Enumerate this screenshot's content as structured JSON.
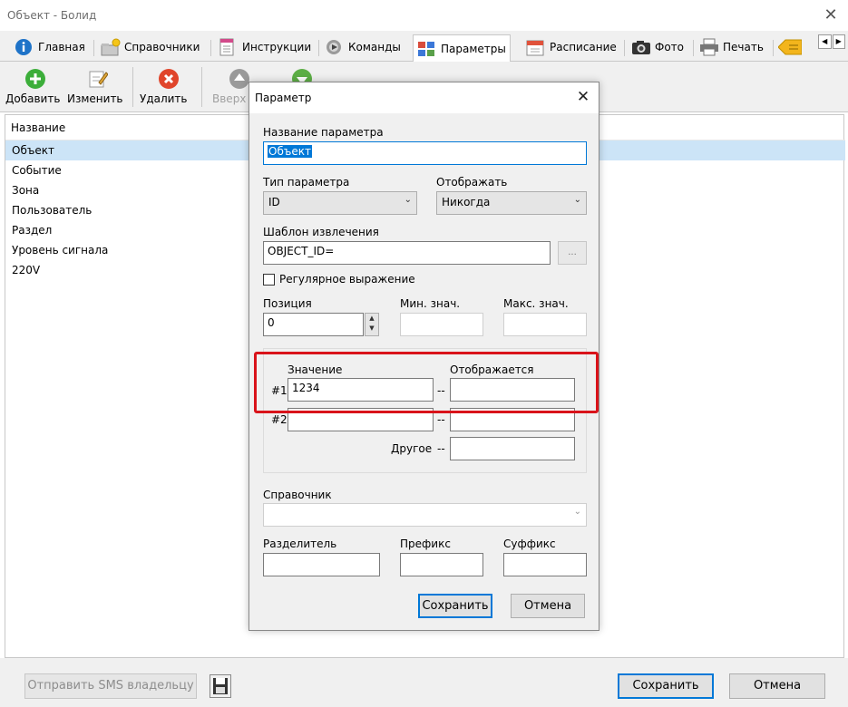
{
  "window": {
    "title": "Объект - Болид",
    "close_glyph": "✕"
  },
  "tabs": [
    {
      "label": "Главная",
      "icon": "info-icon"
    },
    {
      "label": "Справочники",
      "icon": "folder-star-icon"
    },
    {
      "label": "Инструкции",
      "icon": "document-icon"
    },
    {
      "label": "Команды",
      "icon": "gear-play-icon"
    },
    {
      "label": "Параметры",
      "icon": "grid-icon",
      "active": true
    },
    {
      "label": "Расписание",
      "icon": "calendar-icon"
    },
    {
      "label": "Фото",
      "icon": "camera-icon"
    },
    {
      "label": "Печать",
      "icon": "printer-icon"
    }
  ],
  "tab_scroll": {
    "left": "◀",
    "right": "▶"
  },
  "toolbar": {
    "add": "Добавить",
    "edit": "Изменить",
    "delete": "Удалить",
    "up": "Вверх"
  },
  "list": {
    "header": "Название",
    "items": [
      "Объект",
      "Событие",
      "Зона",
      "Пользователь",
      "Раздел",
      "Уровень сигнала",
      "220V"
    ],
    "selected_index": 0
  },
  "bottom": {
    "sms_button": "Отправить SMS владельцу",
    "save_button": "Сохранить",
    "cancel_button": "Отмена"
  },
  "dialog": {
    "title": "Параметр",
    "close_glyph": "✕",
    "param_name_label": "Название параметра",
    "param_name_value": "Объект",
    "param_type_label": "Тип параметра",
    "param_type_value": "ID",
    "display_label": "Отображать",
    "display_value": "Никогда",
    "template_label": "Шаблон извлечения",
    "template_value": "OBJECT_ID=",
    "browse_label": "...",
    "regex_label": "Регулярное выражение",
    "regex_checked": false,
    "position_label": "Позиция",
    "position_value": "0",
    "min_label": "Мин. знач.",
    "max_label": "Макс. знач.",
    "value_col_label": "Значение",
    "shown_col_label": "Отображается",
    "row1_label": "#1",
    "row1_value": "1234",
    "row1_shown": "",
    "row2_label": "#2",
    "row2_value": "",
    "row2_shown": "",
    "dash": "--",
    "other_label": "Другое",
    "other_value": "",
    "reference_label": "Справочник",
    "separator_label": "Разделитель",
    "prefix_label": "Префикс",
    "suffix_label": "Суффикс",
    "save_button": "Сохранить",
    "cancel_button": "Отмена"
  },
  "colors": {
    "selection": "#cce4f7",
    "accent": "#0078d7",
    "highlight_frame": "#d9131a",
    "add_icon": "#3cae3a",
    "delete_icon": "#e0452b"
  }
}
